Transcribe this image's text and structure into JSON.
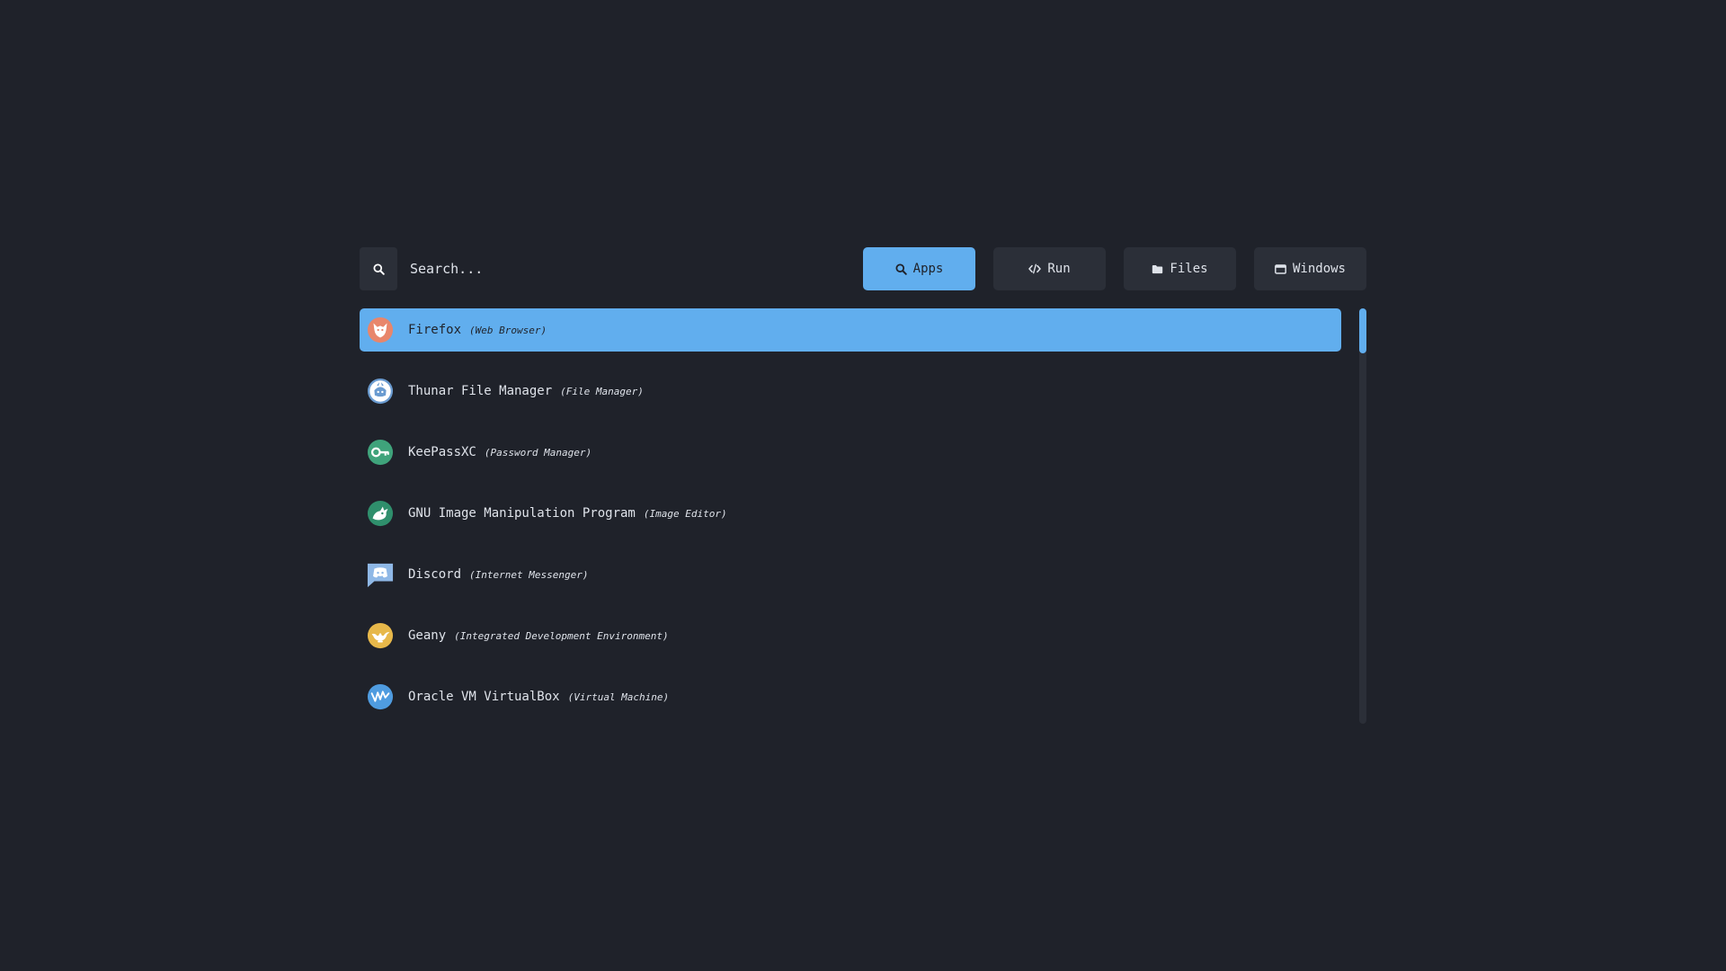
{
  "search": {
    "placeholder": "Search...",
    "icon": "search-icon"
  },
  "modes": [
    {
      "label": "Apps",
      "icon": "search-icon",
      "active": true
    },
    {
      "label": "Run",
      "icon": "code-icon",
      "active": false
    },
    {
      "label": "Files",
      "icon": "folder-icon",
      "active": false
    },
    {
      "label": "Windows",
      "icon": "window-icon",
      "active": false
    }
  ],
  "apps": [
    {
      "name": "Firefox",
      "desc": "(Web Browser)",
      "icon": "firefox-icon",
      "selected": true
    },
    {
      "name": "Thunar File Manager",
      "desc": "(File Manager)",
      "icon": "thunar-icon",
      "selected": false
    },
    {
      "name": "KeePassXC",
      "desc": "(Password Manager)",
      "icon": "keepassxc-icon",
      "selected": false
    },
    {
      "name": "GNU Image Manipulation Program",
      "desc": "(Image Editor)",
      "icon": "gimp-icon",
      "selected": false
    },
    {
      "name": "Discord",
      "desc": "(Internet Messenger)",
      "icon": "discord-icon",
      "selected": false
    },
    {
      "name": "Geany",
      "desc": "(Integrated Development Environment)",
      "icon": "geany-icon",
      "selected": false
    },
    {
      "name": "Oracle VM VirtualBox",
      "desc": "(Virtual Machine)",
      "icon": "virtualbox-icon",
      "selected": false
    }
  ],
  "colors": {
    "background": "#1f222a",
    "surface": "#2b2f38",
    "accent": "#61aeee",
    "text": "#dfe3ea"
  }
}
